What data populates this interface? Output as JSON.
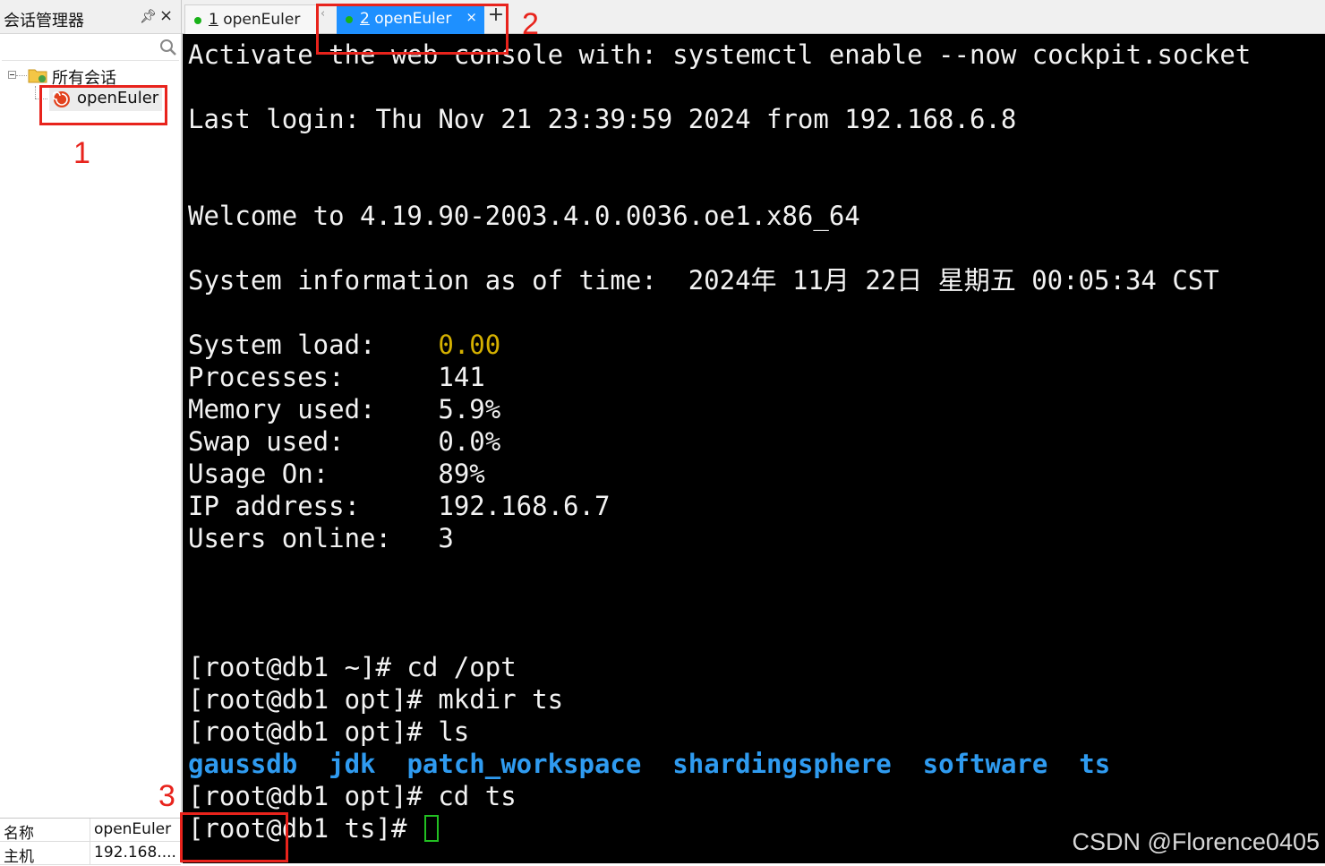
{
  "session_manager": {
    "title": "会话管理器",
    "pin_icon": "pin-icon",
    "close_icon": "close-icon",
    "search": {
      "placeholder": "",
      "icon": "search-icon"
    },
    "tree": {
      "folder_label": "所有会话",
      "sessions": [
        {
          "label": "openEuler",
          "icon": "swirl-icon"
        }
      ]
    },
    "properties": [
      {
        "key": "名称",
        "value": "openEuler"
      },
      {
        "key": "主机",
        "value": "192.168...."
      }
    ]
  },
  "tabs": [
    {
      "number": "1",
      "label": "openEuler",
      "active": false
    },
    {
      "number": "2",
      "label": "openEuler",
      "active": true,
      "close": "×"
    }
  ],
  "add_tab": "+",
  "terminal": {
    "activate_line": "Activate the web console with: systemctl enable --now cockpit.socket",
    "last_login": "Last login: Thu Nov 21 23:39:59 2024 from 192.168.6.8",
    "welcome": "Welcome to 4.19.90-2003.4.0.0036.oe1.x86_64",
    "sysinfo": "System information as of time:  2024年 11月 22日 星期五 00:05:34 CST",
    "stats": [
      {
        "label": "System load:    ",
        "value": "0.00"
      },
      {
        "label": "Processes:      ",
        "value": "141"
      },
      {
        "label": "Memory used:    ",
        "value": "5.9%"
      },
      {
        "label": "Swap used:      ",
        "value": "0.0%"
      },
      {
        "label": "Usage On:       ",
        "value": "89%"
      },
      {
        "label": "IP address:     ",
        "value": "192.168.6.7"
      },
      {
        "label": "Users online:   ",
        "value": "3"
      }
    ],
    "commands": [
      "[root@db1 ~]# cd /opt",
      "[root@db1 opt]# mkdir ts",
      "[root@db1 opt]# ls"
    ],
    "ls_output": [
      "gaussdb",
      "jdk",
      "patch_workspace",
      "shardingsphere",
      "software",
      "ts"
    ],
    "cd_line": "[root@db1 opt]# cd ts",
    "prompt": "[root@db1 ts]# "
  },
  "annotations": [
    "1",
    "2",
    "3"
  ],
  "watermark": "CSDN @Florence0405",
  "colors": {
    "accent_tab": "#1e90ff",
    "annotation_red": "#e8231c",
    "terminal_bg": "#000000",
    "load_value": "#d4b000",
    "directory": "#2f9bf0",
    "cursor": "#22c022"
  }
}
